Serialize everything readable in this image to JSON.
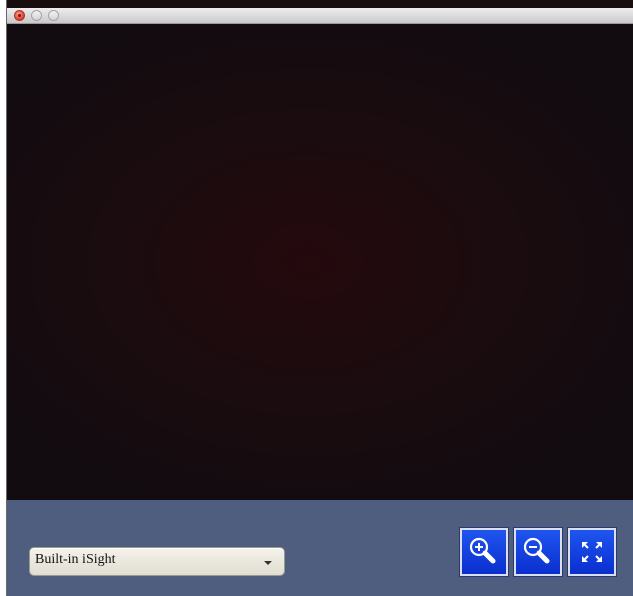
{
  "window": {
    "titlebar_buttons": [
      "close",
      "minimize",
      "maximize"
    ]
  },
  "video": {
    "description_color": "#1a0c0f"
  },
  "toolbar": {
    "camera_select": {
      "selected": "Built-in iSight"
    },
    "buttons": [
      {
        "name": "zoom-in",
        "icon": "zoom-in-icon"
      },
      {
        "name": "zoom-out",
        "icon": "zoom-out-icon"
      },
      {
        "name": "fullscreen",
        "icon": "fullscreen-icon"
      }
    ],
    "background_color": "#4f5e7e",
    "button_color": "#1446e6"
  }
}
